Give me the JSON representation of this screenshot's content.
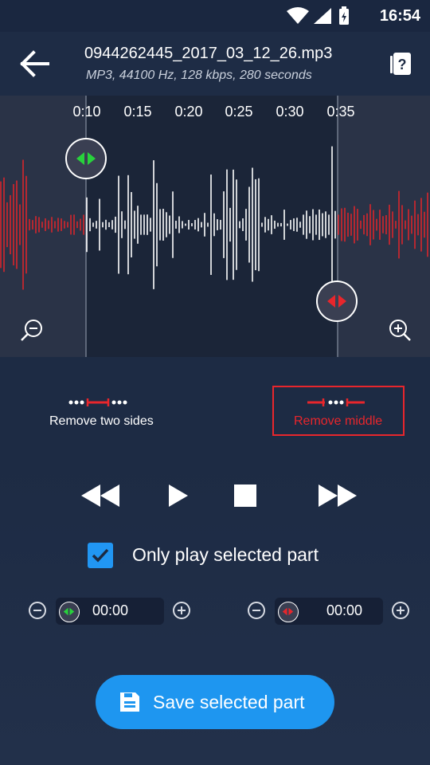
{
  "status": {
    "time": "16:54"
  },
  "file": {
    "name": "0944262445_2017_03_12_26.mp3",
    "info": "MP3, 44100 Hz, 128 kbps, 280 seconds"
  },
  "timeline": {
    "ticks": [
      "0:10",
      "0:15",
      "0:20",
      "0:25",
      "0:30",
      "0:35"
    ]
  },
  "modes": {
    "two_sides": "Remove two sides",
    "middle": "Remove middle"
  },
  "options": {
    "only_play_selected": "Only play selected part",
    "only_play_checked": true
  },
  "start_time": {
    "value": "00:00"
  },
  "end_time": {
    "value": "00:00"
  },
  "save": {
    "label": "Save selected part"
  },
  "colors": {
    "accent": "#1e96f0",
    "selection": "#e8262c",
    "start_handle": "#28d23c",
    "background": "#1c2a42"
  }
}
